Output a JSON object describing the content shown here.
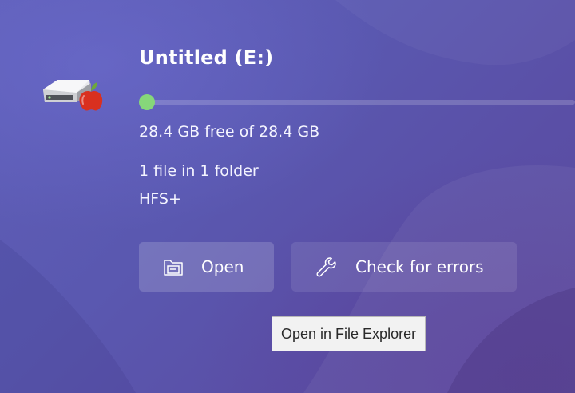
{
  "drive": {
    "title": "Untitled (E:)",
    "usage_fraction_used": 0.0,
    "free_text": "28.4 GB free of 28.4 GB",
    "files_text": "1 file in 1 folder",
    "filesystem": "HFS+",
    "icon": "hard-drive-apple-icon"
  },
  "actions": {
    "open_label": "Open",
    "open_icon": "folder-open-icon",
    "check_label": "Check for errors",
    "check_icon": "wrench-icon"
  },
  "tooltip": {
    "text": "Open in File Explorer"
  },
  "colors": {
    "usage_dot": "#86d77a",
    "apple": "#d9301f"
  }
}
